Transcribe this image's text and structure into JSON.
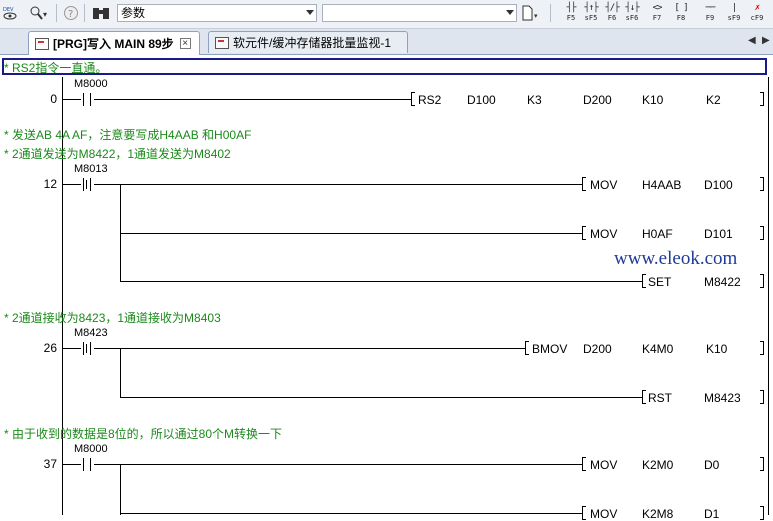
{
  "toolbar": {
    "combo_value": "参数",
    "fkeys": [
      {
        "sym": "┤├",
        "label": "F5"
      },
      {
        "sym": "┤↑├",
        "label": "sF5"
      },
      {
        "sym": "┤/├",
        "label": "F6"
      },
      {
        "sym": "┤↓├",
        "label": "sF6"
      },
      {
        "sym": "<>",
        "label": "F7"
      },
      {
        "sym": "[ ]",
        "label": "F8"
      },
      {
        "sym": "──",
        "label": "F9"
      },
      {
        "sym": "|",
        "label": "sF9"
      },
      {
        "sym": "✗",
        "label": "cF9"
      }
    ]
  },
  "tabs": [
    {
      "label": "[PRG]写入 MAIN 89步"
    },
    {
      "label": "软元件/缓冲存储器批量监视-1"
    }
  ],
  "ladder": {
    "rung0": {
      "comment": "* RS2指令一直通。",
      "step": "0",
      "contact": "M8000",
      "instr": [
        "RS2",
        "D100",
        "K3",
        "D200",
        "K10",
        "K2"
      ]
    },
    "rung12": {
      "comment1": "* 发送AB 4A AF，注意要写成H4AAB 和H00AF",
      "comment2": "* 2通道发送为M8422，1通道发送为M8402",
      "step": "12",
      "contact": "M8013",
      "instr1": [
        "MOV",
        "H4AAB",
        "D100"
      ],
      "instr2": [
        "MOV",
        "H0AF",
        "D101"
      ],
      "instr3": [
        "SET",
        "M8422"
      ]
    },
    "rung26": {
      "comment": "* 2通道接收为8423，1通道接收为M8403",
      "step": "26",
      "contact": "M8423",
      "instr1": [
        "BMOV",
        "D200",
        "K4M0",
        "K10"
      ],
      "instr2": [
        "RST",
        "M8423"
      ]
    },
    "rung37": {
      "comment": "* 由于收到的数据是8位的，所以通过80个M转换一下",
      "step": "37",
      "contact": "M8000",
      "instr1": [
        "MOV",
        "K2M0",
        "D0"
      ],
      "instr2": [
        "MOV",
        "K2M8",
        "D1"
      ]
    }
  },
  "watermark": "www.eleok.com"
}
